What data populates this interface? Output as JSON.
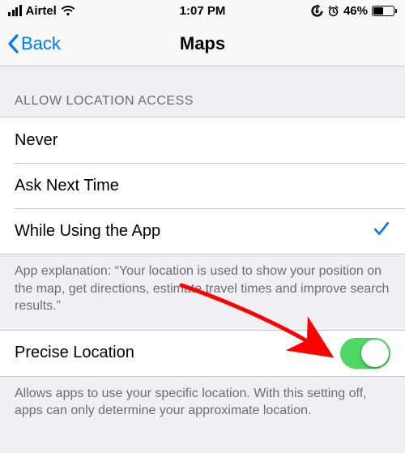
{
  "status": {
    "carrier": "Airtel",
    "time": "1:07 PM",
    "battery_pct": "46%"
  },
  "nav": {
    "back_label": "Back",
    "title": "Maps"
  },
  "section": {
    "header": "ALLOW LOCATION ACCESS",
    "options": {
      "never": "Never",
      "ask": "Ask Next Time",
      "while": "While Using the App"
    },
    "selected": "while",
    "footer": "App explanation: “Your location is used to show your position on the map, get directions, estimate travel times and improve search results.”"
  },
  "precise": {
    "label": "Precise Location",
    "enabled": true,
    "footer": "Allows apps to use your specific location. With this setting off, apps can only determine your approximate location."
  },
  "colors": {
    "tint": "#007aff",
    "toggle_on": "#4cd964",
    "arrow": "#ff0000"
  }
}
